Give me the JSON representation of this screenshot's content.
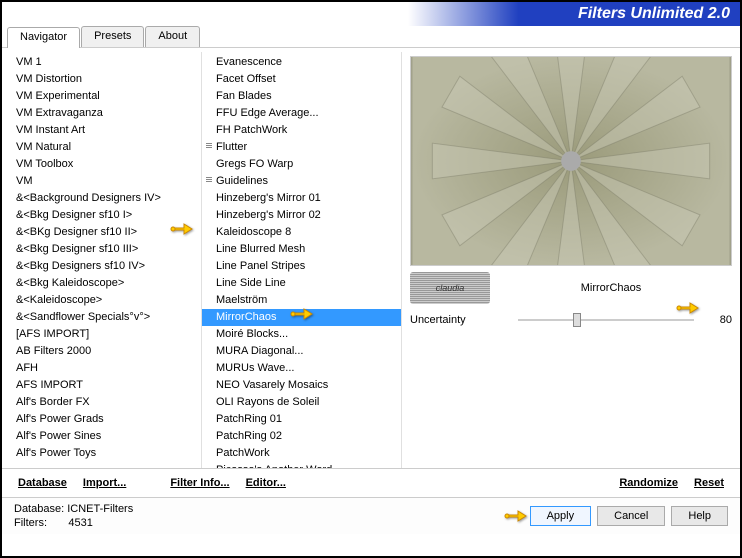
{
  "window": {
    "title": "Filters Unlimited 2.0"
  },
  "tabs": [
    {
      "label": "Navigator",
      "active": true
    },
    {
      "label": "Presets",
      "active": false
    },
    {
      "label": "About",
      "active": false
    }
  ],
  "categories": [
    "VM 1",
    "VM Distortion",
    "VM Experimental",
    "VM Extravaganza",
    "VM Instant Art",
    "VM Natural",
    "VM Toolbox",
    "VM",
    "&<Background Designers IV>",
    "&<Bkg Designer sf10 I>",
    "&<BKg Designer sf10 II>",
    "&<Bkg Designer sf10 III>",
    "&<Bkg Designers sf10 IV>",
    "&<Bkg Kaleidoscope>",
    "&<Kaleidoscope>",
    "&<Sandflower Specials°v°>",
    "[AFS IMPORT]",
    "AB Filters 2000",
    "AFH",
    "AFS IMPORT",
    "Alf's Border FX",
    "Alf's Power Grads",
    "Alf's Power Sines",
    "Alf's Power Toys"
  ],
  "category_selected_index": 10,
  "filters": [
    {
      "label": "Evanescence",
      "grip": false
    },
    {
      "label": "Facet Offset",
      "grip": false
    },
    {
      "label": "Fan Blades",
      "grip": false
    },
    {
      "label": "FFU Edge Average...",
      "grip": false
    },
    {
      "label": "FH PatchWork",
      "grip": false
    },
    {
      "label": "Flutter",
      "grip": true
    },
    {
      "label": "Gregs FO Warp",
      "grip": false
    },
    {
      "label": "Guidelines",
      "grip": true
    },
    {
      "label": "Hinzeberg's Mirror 01",
      "grip": false
    },
    {
      "label": "Hinzeberg's Mirror 02",
      "grip": false
    },
    {
      "label": "Kaleidoscope 8",
      "grip": false
    },
    {
      "label": "Line Blurred Mesh",
      "grip": false
    },
    {
      "label": "Line Panel Stripes",
      "grip": false
    },
    {
      "label": "Line Side Line",
      "grip": false
    },
    {
      "label": "Maelström",
      "grip": false
    },
    {
      "label": "MirrorChaos",
      "grip": false
    },
    {
      "label": "Moiré Blocks...",
      "grip": false
    },
    {
      "label": "MURA Diagonal...",
      "grip": false
    },
    {
      "label": "MURUs Wave...",
      "grip": false
    },
    {
      "label": "NEO Vasarely Mosaics",
      "grip": false
    },
    {
      "label": "OLI Rayons de Soleil",
      "grip": false
    },
    {
      "label": "PatchRing 01",
      "grip": false
    },
    {
      "label": "PatchRing 02",
      "grip": false
    },
    {
      "label": "PatchWork",
      "grip": false
    },
    {
      "label": "Picasso's Another Word...",
      "grip": false
    }
  ],
  "filter_selected_index": 15,
  "selected_filter_name": "MirrorChaos",
  "watermark_text": "claudia",
  "params": [
    {
      "label": "Uncertainty",
      "value": 80,
      "pos_pct": 31
    }
  ],
  "toolbar": {
    "database": "Database",
    "import": "Import...",
    "filterinfo": "Filter Info...",
    "editor": "Editor...",
    "randomize": "Randomize",
    "reset": "Reset"
  },
  "status": {
    "db_label": "Database:",
    "db_value": "ICNET-Filters",
    "filters_label": "Filters:",
    "filters_value": "4531"
  },
  "buttons": {
    "apply": "Apply",
    "cancel": "Cancel",
    "help": "Help"
  }
}
